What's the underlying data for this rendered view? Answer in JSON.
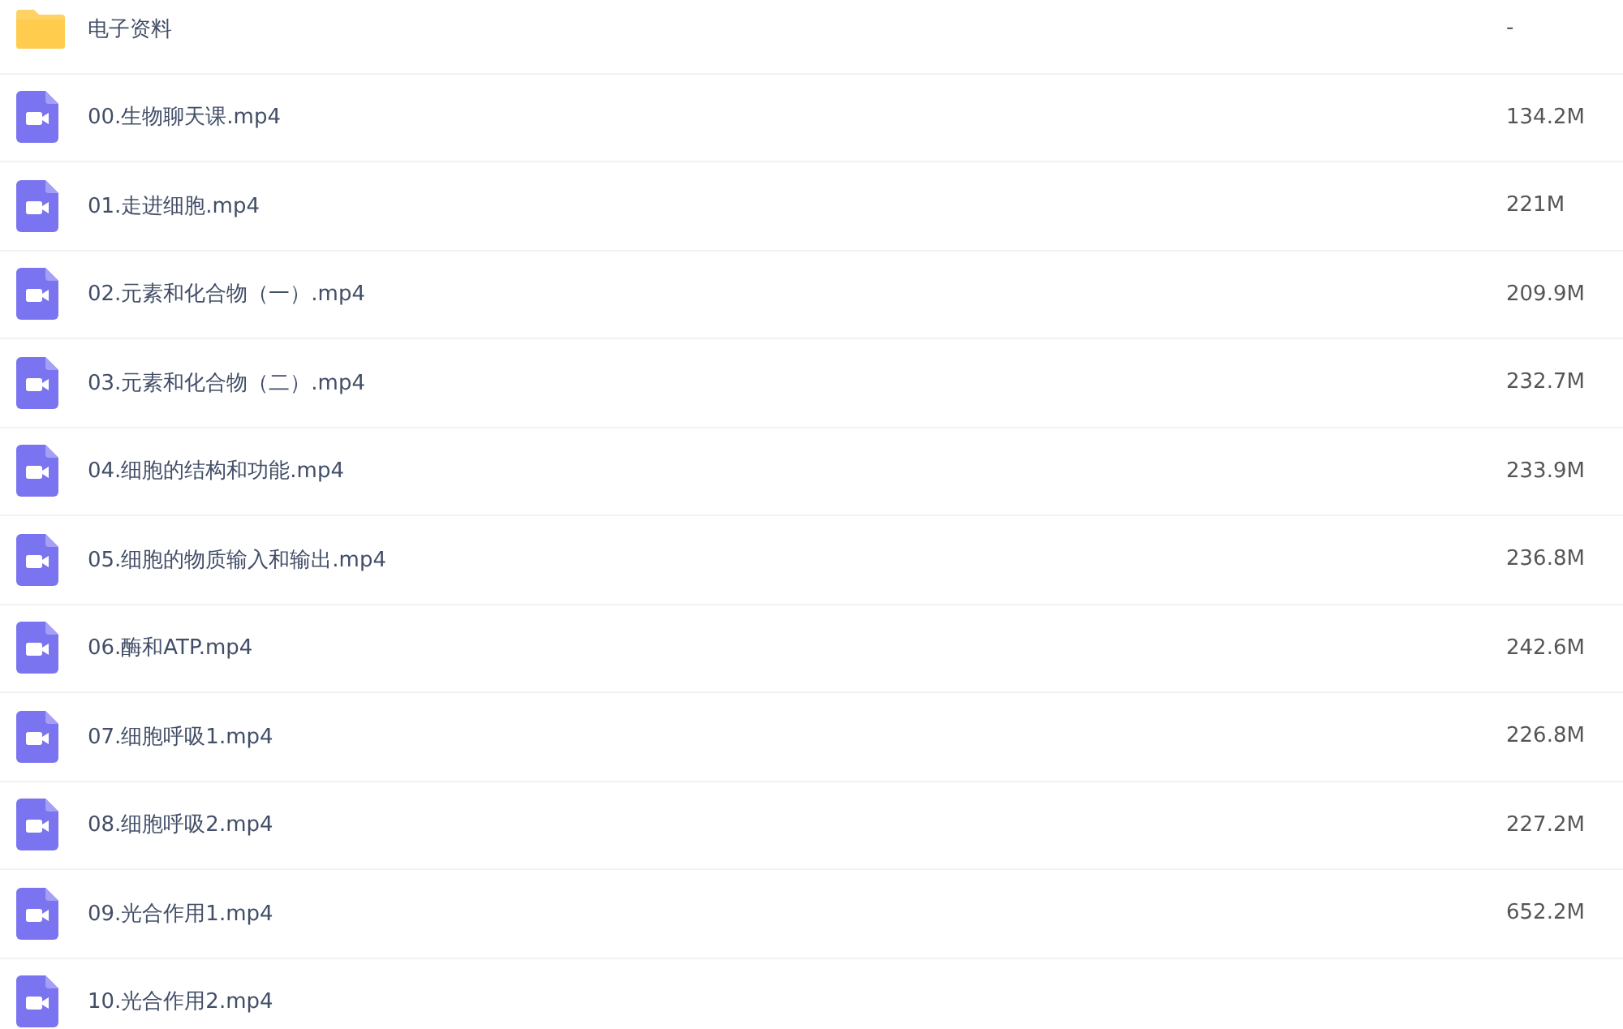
{
  "files": [
    {
      "kind": "folder",
      "name": "电子资料",
      "size": "-"
    },
    {
      "kind": "video",
      "name": "00.生物聊天课.mp4",
      "size": "134.2M"
    },
    {
      "kind": "video",
      "name": "01.走进细胞.mp4",
      "size": "221M"
    },
    {
      "kind": "video",
      "name": "02.元素和化合物（一）.mp4",
      "size": "209.9M"
    },
    {
      "kind": "video",
      "name": "03.元素和化合物（二）.mp4",
      "size": "232.7M"
    },
    {
      "kind": "video",
      "name": "04.细胞的结构和功能.mp4",
      "size": "233.9M"
    },
    {
      "kind": "video",
      "name": "05.细胞的物质输入和输出.mp4",
      "size": "236.8M"
    },
    {
      "kind": "video",
      "name": "06.酶和ATP.mp4",
      "size": "242.6M"
    },
    {
      "kind": "video",
      "name": "07.细胞呼吸1.mp4",
      "size": "226.8M"
    },
    {
      "kind": "video",
      "name": "08.细胞呼吸2.mp4",
      "size": "227.2M"
    },
    {
      "kind": "video",
      "name": "09.光合作用1.mp4",
      "size": "652.2M"
    },
    {
      "kind": "video",
      "name": "10.光合作用2.mp4"
    }
  ]
}
